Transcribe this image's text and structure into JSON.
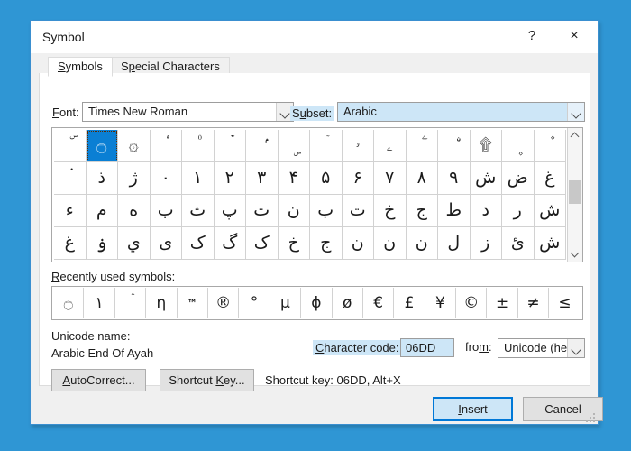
{
  "window": {
    "title": "Symbol",
    "help_glyph": "?",
    "close_glyph": "×"
  },
  "tabs": [
    {
      "id": "symbols",
      "label": "Symbols",
      "accel": "S",
      "active": true
    },
    {
      "id": "special-characters",
      "label": "Special Characters",
      "accel": "p",
      "active": false
    }
  ],
  "font": {
    "label": "Font:",
    "accel": "F",
    "value": "Times New Roman"
  },
  "subset": {
    "label": "Subset:",
    "accel": "u",
    "value": "Arabic",
    "highlight_color": "#cde6f7"
  },
  "grid": {
    "columns": 16,
    "selected_index": 1,
    "selection_color": "#0a7fd4",
    "cells": [
      "ۜ",
      "۝",
      "۞",
      "۟",
      "۠",
      "ۡ",
      "ۢ",
      "ۣ",
      "ۤ",
      "ۥ",
      "ۦ",
      "ۧ",
      "ۨ",
      "۩",
      "۪",
      "۫",
      "۬",
      "ذ",
      "ژ",
      "۰",
      "۱",
      "۲",
      "۳",
      "۴",
      "۵",
      "۶",
      "۷",
      "۸",
      "۹",
      "ش",
      "ض",
      "غ",
      "ء",
      "م",
      "ه",
      "ب",
      "ث",
      "پ",
      "ت",
      "ن",
      "ب",
      "ت",
      "خ",
      "ج",
      "ط",
      "د",
      "ر",
      "ش",
      "غ",
      "ۏ",
      "ي",
      "ی",
      "ک",
      "گ",
      "ک",
      "خ",
      "ج",
      "ن",
      "ن",
      "ن",
      "ل",
      "ز",
      "ئ",
      "ش"
    ],
    "scrollbar": {
      "up_arrow": "up-arrow",
      "down_arrow": "down-arrow",
      "thumb_position_percent": 36
    }
  },
  "recent": {
    "label": "Recently used symbols:",
    "accel": "R",
    "symbols": [
      {
        "glyph": "۝",
        "small": false
      },
      {
        "glyph": "۱",
        "small": false
      },
      {
        "glyph": "ۡ",
        "small": false
      },
      {
        "glyph": "η",
        "small": false
      },
      {
        "glyph": "™",
        "small": true
      },
      {
        "glyph": "®",
        "small": false
      },
      {
        "glyph": "°",
        "small": false
      },
      {
        "glyph": "µ",
        "small": false
      },
      {
        "glyph": "ϕ",
        "small": false
      },
      {
        "glyph": "ø",
        "small": false
      },
      {
        "glyph": "€",
        "small": false
      },
      {
        "glyph": "£",
        "small": false
      },
      {
        "glyph": "¥",
        "small": false
      },
      {
        "glyph": "©",
        "small": false
      },
      {
        "glyph": "±",
        "small": false
      },
      {
        "glyph": "≠",
        "small": false
      },
      {
        "glyph": "≤",
        "small": false
      }
    ]
  },
  "details": {
    "unicode_name_label": "Unicode name:",
    "unicode_name_value": "Arabic End Of Ayah",
    "character_code_label": "Character code:",
    "character_code_accel": "C",
    "character_code_value": "06DD",
    "from_label": "from:",
    "from_accel": "m",
    "from_value": "Unicode (hex)",
    "highlight_color": "#cde6f7"
  },
  "actions": {
    "autocorrect_label": "AutoCorrect...",
    "autocorrect_accel": "A",
    "shortcut_key_label": "Shortcut Key...",
    "shortcut_key_accel": "K",
    "shortcut_key_status": "Shortcut key: 06DD, Alt+X"
  },
  "footer": {
    "insert_label": "Insert",
    "insert_accel": "I",
    "cancel_label": "Cancel",
    "default_button_color": "#0078d7"
  },
  "desktop": {
    "background_color": "#2f96d4"
  }
}
